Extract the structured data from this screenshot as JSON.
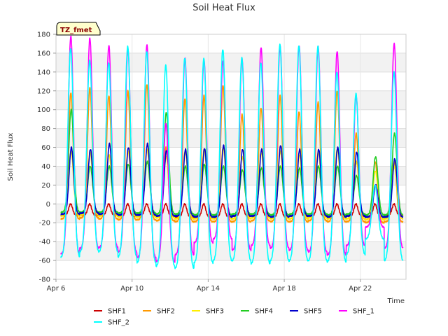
{
  "chart_data": {
    "type": "line",
    "title": "Soil Heat Flux",
    "xlabel": "Time",
    "ylabel": "Soil Heat Flux",
    "badge": "TZ_fmet",
    "ylim": [
      -80,
      180
    ],
    "yticks": [
      -80,
      -60,
      -40,
      -20,
      0,
      20,
      40,
      60,
      80,
      100,
      120,
      140,
      160,
      180
    ],
    "x_start": "Apr 6",
    "xlim_days": [
      6.0,
      24.4
    ],
    "xticks": [
      {
        "label": "Apr 6",
        "day": 6
      },
      {
        "label": "Apr 10",
        "day": 10
      },
      {
        "label": "Apr 14",
        "day": 14
      },
      {
        "label": "Apr 18",
        "day": 18
      },
      {
        "label": "Apr 22",
        "day": 22
      }
    ],
    "grid": true,
    "legend_placement": "bottom",
    "series": [
      {
        "name": "SHF1",
        "color": "#cc0000",
        "min": [
          -12,
          -12,
          -12,
          -13,
          -12,
          -13,
          -14,
          -14,
          -14,
          -13,
          -13,
          -14,
          -13,
          -13,
          -13,
          -13,
          -14,
          -12
        ],
        "max": [
          0,
          0,
          0,
          0,
          0,
          0,
          0,
          0,
          0,
          0,
          0,
          0,
          0,
          0,
          0,
          0,
          0,
          0
        ]
      },
      {
        "name": "SHF2",
        "color": "#ff9900",
        "min": [
          -16,
          -15,
          -16,
          -17,
          -17,
          -18,
          -19,
          -19,
          -19,
          -19,
          -18,
          -19,
          -19,
          -18,
          -19,
          -19,
          -20,
          -19
        ],
        "max": [
          118,
          123,
          115,
          120,
          127,
          60,
          112,
          115,
          126,
          95,
          102,
          115,
          98,
          108,
          120,
          75,
          45,
          45
        ]
      },
      {
        "name": "SHF3",
        "color": "#ffee00",
        "min": [
          -13,
          -12,
          -13,
          -14,
          -14,
          -15,
          -16,
          -16,
          -16,
          -16,
          -15,
          -16,
          -16,
          -15,
          -16,
          -16,
          -17,
          -16
        ],
        "max": [
          55,
          55,
          52,
          56,
          58,
          50,
          56,
          58,
          60,
          50,
          54,
          56,
          52,
          55,
          58,
          45,
          35,
          40
        ]
      },
      {
        "name": "SHF4",
        "color": "#22cc22",
        "min": [
          -9,
          -9,
          -9,
          -10,
          -10,
          -11,
          -11,
          -12,
          -12,
          -11,
          -11,
          -12,
          -11,
          -11,
          -12,
          -11,
          -12,
          -12
        ],
        "max": [
          100,
          40,
          40,
          42,
          45,
          97,
          40,
          42,
          40,
          36,
          38,
          40,
          38,
          40,
          40,
          30,
          50,
          75
        ]
      },
      {
        "name": "SHF5",
        "color": "#0000cc",
        "min": [
          -11,
          -10,
          -11,
          -12,
          -12,
          -13,
          -13,
          -14,
          -14,
          -13,
          -13,
          -14,
          -13,
          -13,
          -14,
          -13,
          -14,
          -14
        ],
        "max": [
          60,
          58,
          64,
          60,
          64,
          57,
          58,
          59,
          62,
          58,
          58,
          62,
          58,
          58,
          60,
          55,
          20,
          48
        ]
      },
      {
        "name": "SHF_1",
        "color": "#ff00ff",
        "min": [
          -54,
          -48,
          -47,
          -52,
          -58,
          -62,
          -55,
          -42,
          -38,
          -50,
          -45,
          -48,
          -50,
          -52,
          -55,
          -45,
          -25,
          -48
        ],
        "max": [
          178,
          176,
          168,
          165,
          169,
          85,
          155,
          153,
          152,
          154,
          166,
          168,
          168,
          167,
          162,
          115,
          20,
          170
        ]
      },
      {
        "name": "SHF_2",
        "color": "#00ffff",
        "min": [
          -58,
          -52,
          -52,
          -58,
          -64,
          -68,
          -70,
          -64,
          -62,
          -62,
          -65,
          -62,
          -62,
          -62,
          -63,
          -55,
          -38,
          -62
        ],
        "max": [
          165,
          152,
          150,
          167,
          162,
          147,
          155,
          154,
          164,
          155,
          150,
          169,
          168,
          167,
          140,
          117,
          20,
          140
        ]
      }
    ]
  }
}
